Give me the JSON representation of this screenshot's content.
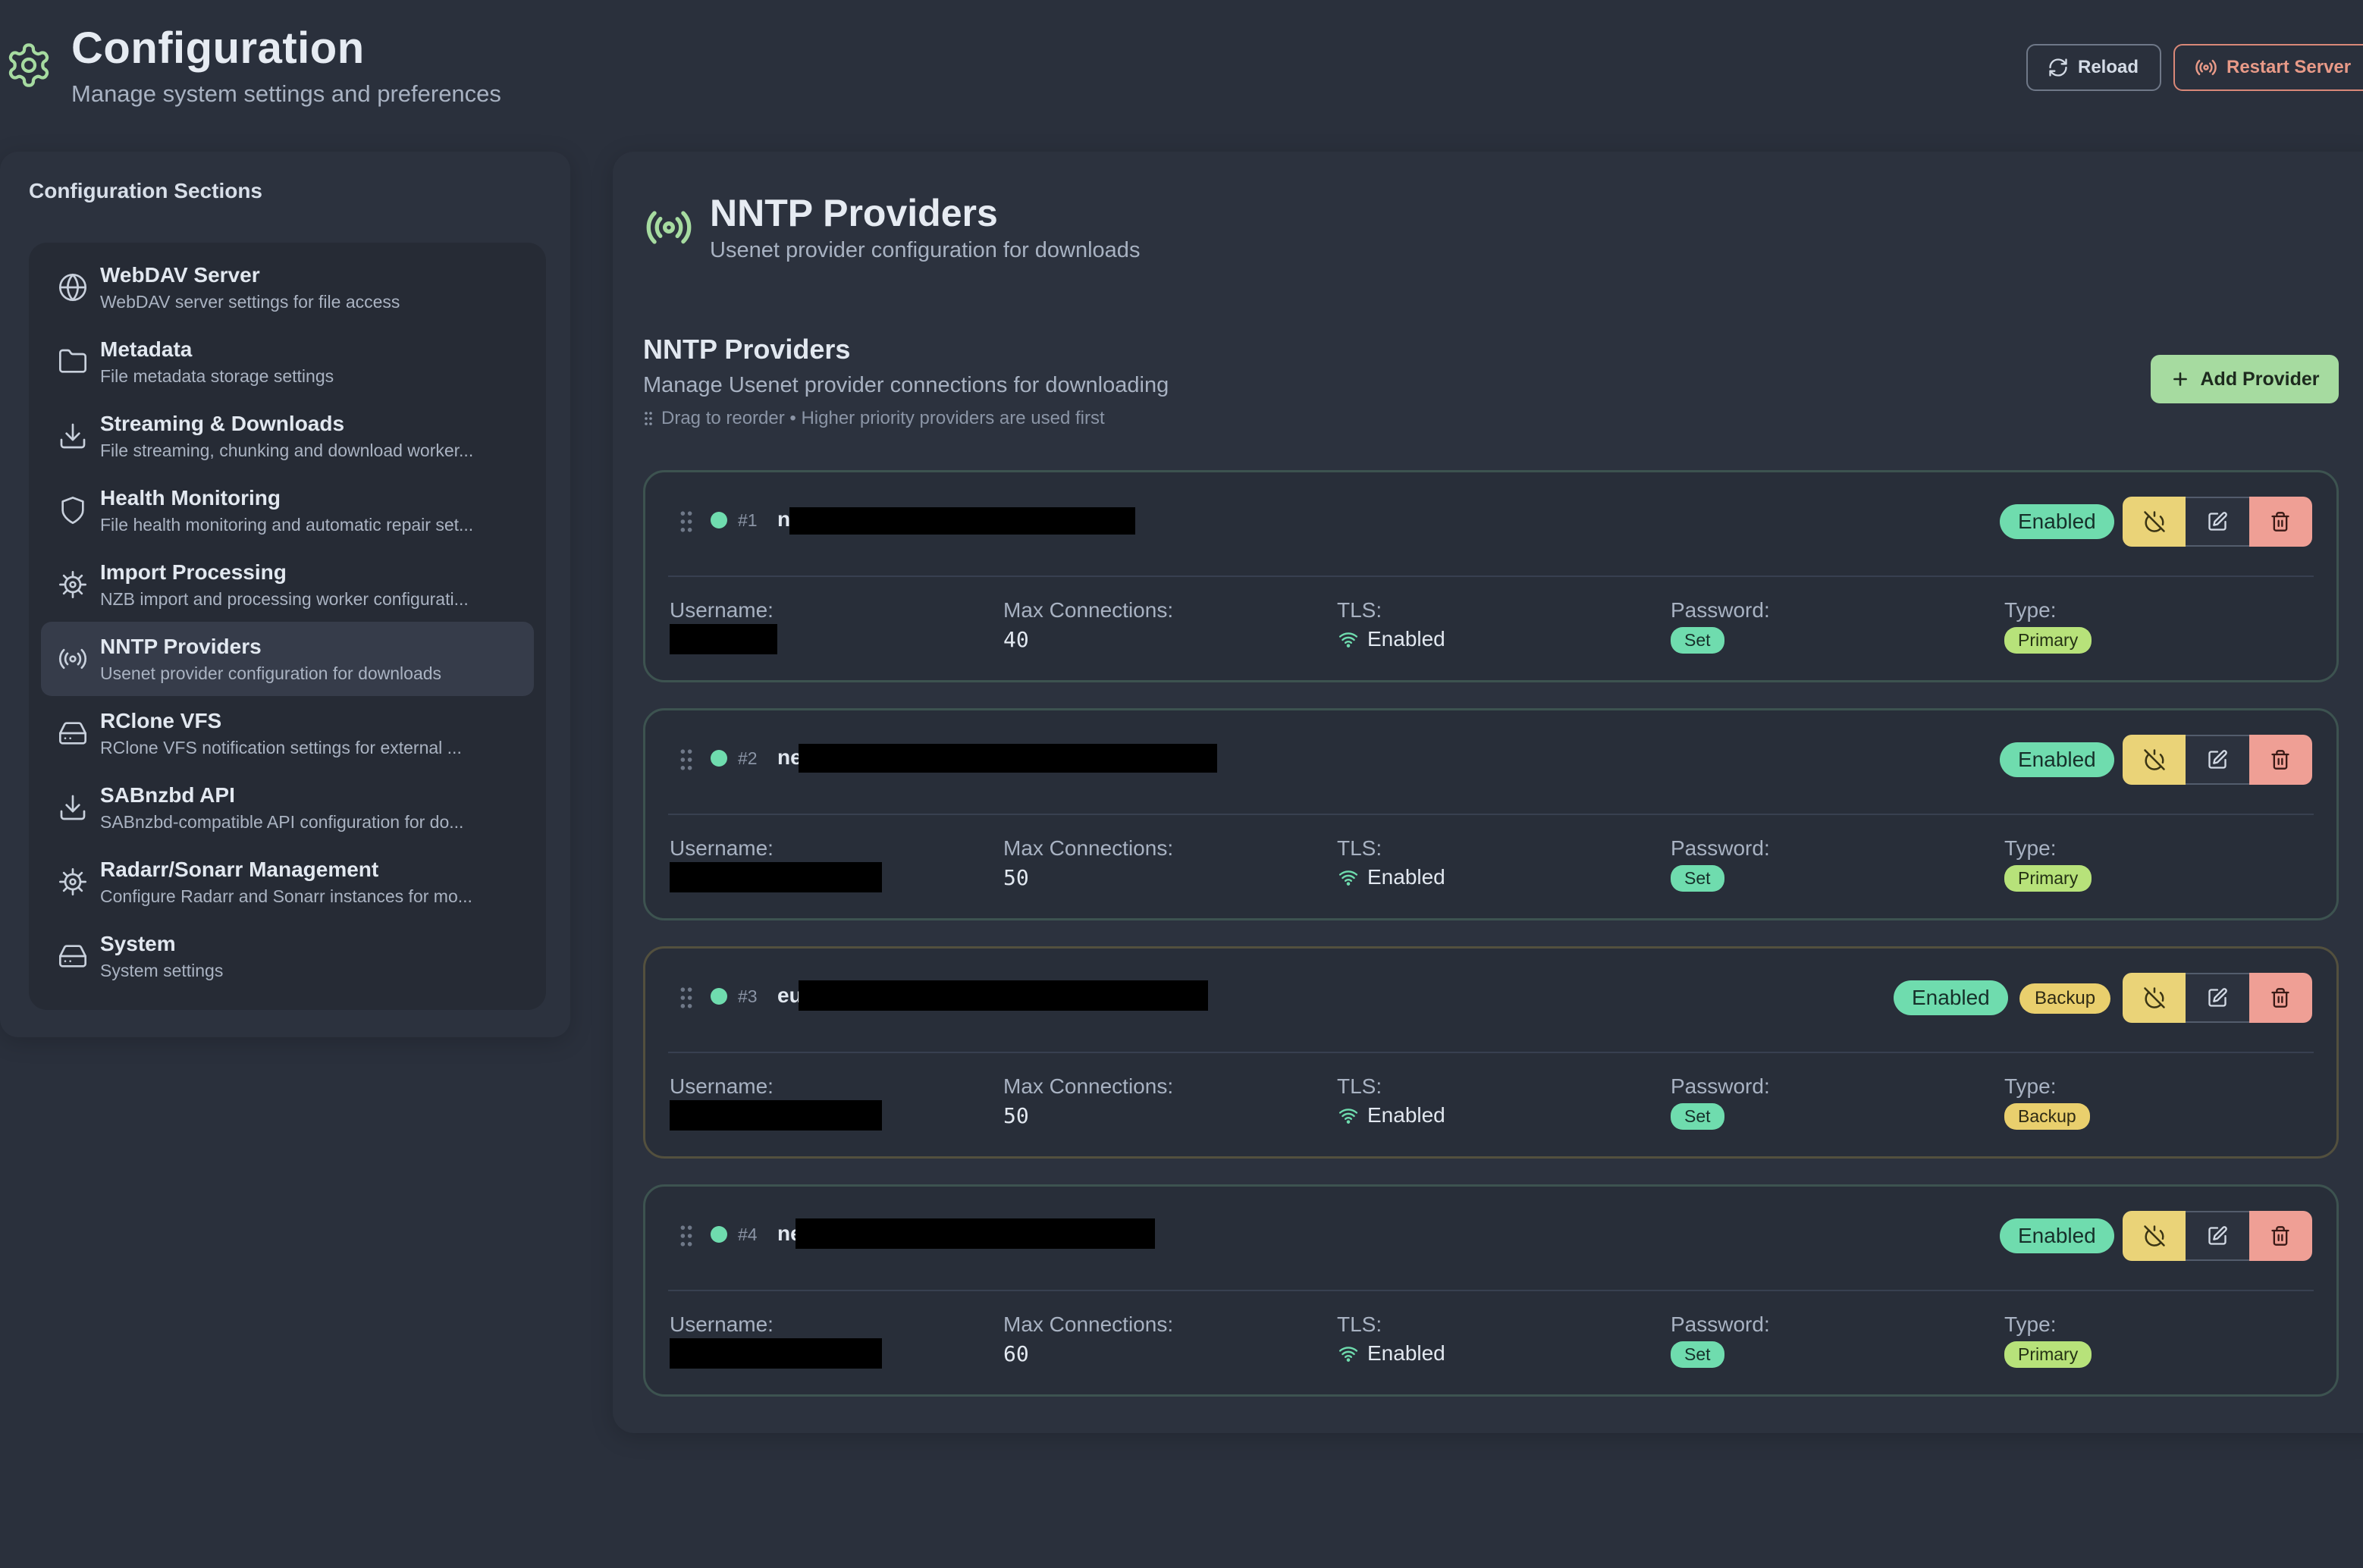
{
  "header": {
    "title": "Configuration",
    "subtitle": "Manage system settings and preferences",
    "reload_label": "Reload",
    "restart_label": "Restart Server"
  },
  "sidebar": {
    "heading": "Configuration Sections",
    "items": [
      {
        "label": "WebDAV Server",
        "desc": "WebDAV server settings for file access",
        "icon": "globe-icon"
      },
      {
        "label": "Metadata",
        "desc": "File metadata storage settings",
        "icon": "folder-icon"
      },
      {
        "label": "Streaming & Downloads",
        "desc": "File streaming, chunking and download worker...",
        "icon": "download-icon"
      },
      {
        "label": "Health Monitoring",
        "desc": "File health monitoring and automatic repair set...",
        "icon": "shield-icon"
      },
      {
        "label": "Import Processing",
        "desc": "NZB import and processing worker configurati...",
        "icon": "cog-icon"
      },
      {
        "label": "NNTP Providers",
        "desc": "Usenet provider configuration for downloads",
        "icon": "broadcast-icon",
        "active": true
      },
      {
        "label": "RClone VFS",
        "desc": "RClone VFS notification settings for external ...",
        "icon": "drive-icon"
      },
      {
        "label": "SABnzbd API",
        "desc": "SABnzbd-compatible API configuration for do...",
        "icon": "download-icon"
      },
      {
        "label": "Radarr/Sonarr Management",
        "desc": "Configure Radarr and Sonarr instances for mo...",
        "icon": "cog-icon"
      },
      {
        "label": "System",
        "desc": "System settings",
        "icon": "drive-icon"
      }
    ]
  },
  "main": {
    "title": "NNTP Providers",
    "subtitle": "Usenet provider configuration for downloads",
    "section_title": "NNTP Providers",
    "section_subtitle": "Manage Usenet provider connections for downloading",
    "hint": "Drag to reorder • Higher priority providers are used first",
    "add_label": "Add Provider"
  },
  "field_labels": {
    "username": "Username:",
    "max_connections": "Max Connections:",
    "tls": "TLS:",
    "password": "Password:",
    "type": "Type:"
  },
  "providers": [
    {
      "num": "#1",
      "name_visible": "n",
      "status": "Enabled",
      "max_connections": "40",
      "tls": "Enabled",
      "password": "Set",
      "type": "Primary"
    },
    {
      "num": "#2",
      "name_visible": "ne",
      "status": "Enabled",
      "max_connections": "50",
      "tls": "Enabled",
      "password": "Set",
      "type": "Primary"
    },
    {
      "num": "#3",
      "name_visible": "eu",
      "status": "Enabled",
      "backup_badge": "Backup",
      "max_connections": "50",
      "tls": "Enabled",
      "password": "Set",
      "type": "Backup"
    },
    {
      "num": "#4",
      "name_visible": "ne",
      "status": "Enabled",
      "max_connections": "60",
      "tls": "Enabled",
      "password": "Set",
      "type": "Primary"
    }
  ],
  "colors": {
    "background": "#2a303c",
    "accent_green": "#a6dba0",
    "enabled_badge": "#6fdcae",
    "backup_badge": "#e9cf6d",
    "danger": "#ef9f95",
    "restart_border": "#d98878"
  }
}
